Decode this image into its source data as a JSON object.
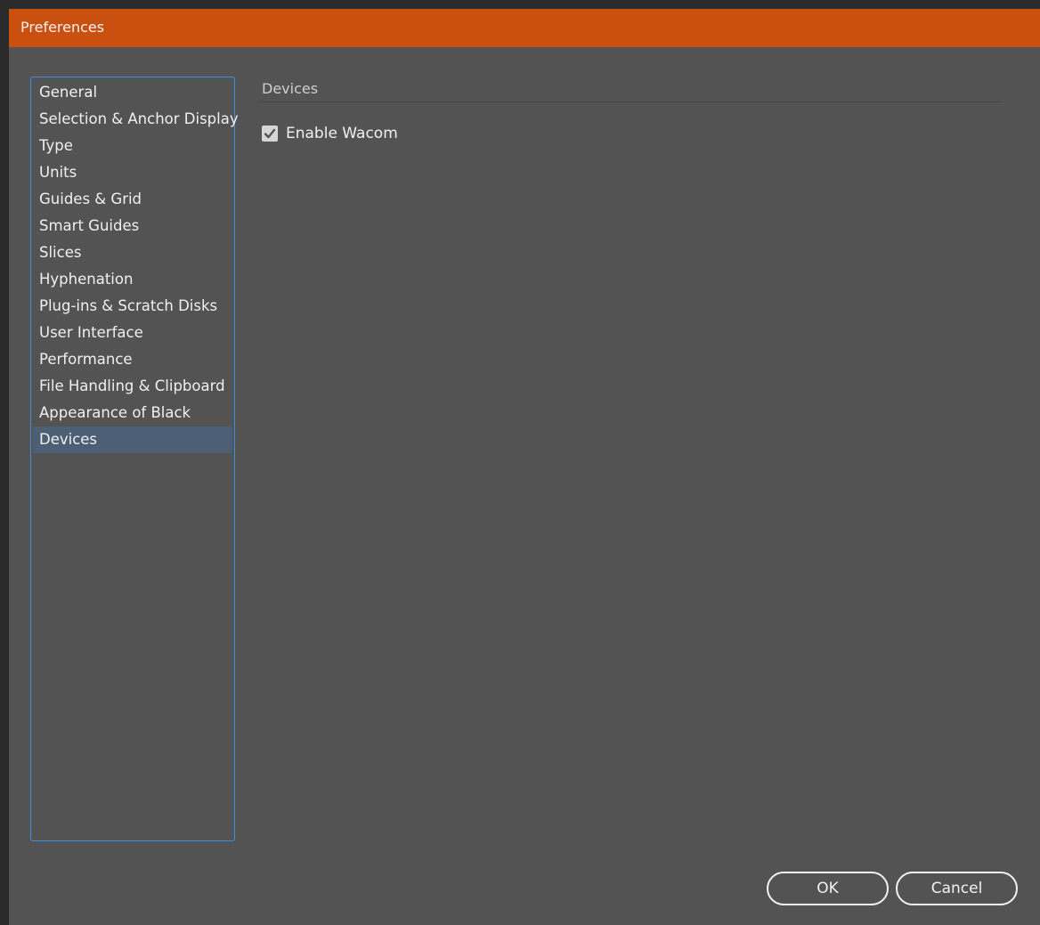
{
  "window": {
    "title": "Preferences",
    "accent_color": "#c9500f"
  },
  "sidebar": {
    "items": [
      {
        "label": "General"
      },
      {
        "label": "Selection & Anchor Display"
      },
      {
        "label": "Type"
      },
      {
        "label": "Units"
      },
      {
        "label": "Guides & Grid"
      },
      {
        "label": "Smart Guides"
      },
      {
        "label": "Slices"
      },
      {
        "label": "Hyphenation"
      },
      {
        "label": "Plug-ins & Scratch Disks"
      },
      {
        "label": "User Interface"
      },
      {
        "label": "Performance"
      },
      {
        "label": "File Handling & Clipboard"
      },
      {
        "label": "Appearance of Black"
      },
      {
        "label": "Devices"
      }
    ],
    "selected": "Devices"
  },
  "main": {
    "section_title": "Devices",
    "enable_wacom": {
      "label": "Enable Wacom",
      "checked": true
    }
  },
  "footer": {
    "ok_label": "OK",
    "cancel_label": "Cancel"
  }
}
